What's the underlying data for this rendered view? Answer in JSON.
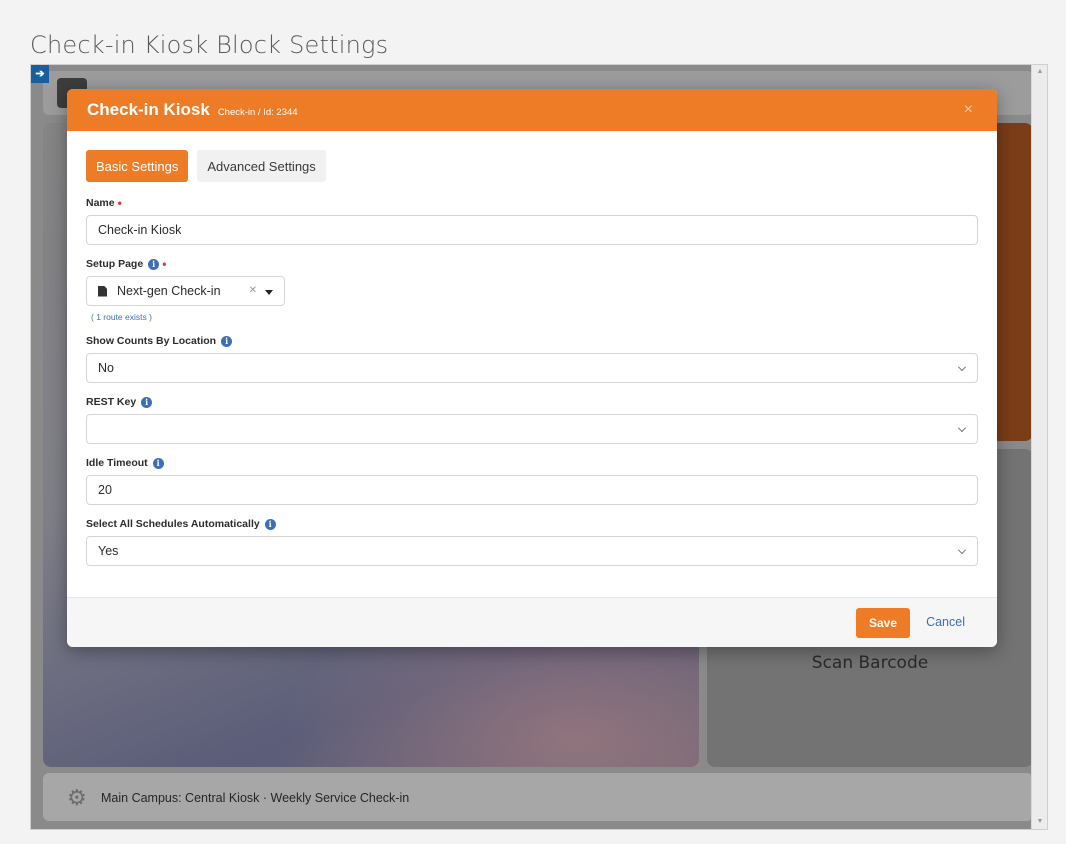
{
  "page": {
    "title": "Check-in Kiosk Block Settings"
  },
  "background": {
    "scan_label": "Scan Barcode",
    "footer_text": "Main Campus: Central Kiosk · Weekly Service Check-in"
  },
  "modal": {
    "title": "Check-in Kiosk",
    "subtitle": "Check-in / Id: 2344",
    "close_glyph": "×",
    "tabs": [
      {
        "label": "Basic Settings",
        "active": true
      },
      {
        "label": "Advanced Settings",
        "active": false
      }
    ],
    "fields": {
      "name": {
        "label": "Name",
        "value": "Check-in Kiosk",
        "required": true
      },
      "setup_page": {
        "label": "Setup Page",
        "value": "Next-gen Check-in",
        "route_note": "( 1 route exists )",
        "required": true
      },
      "show_counts": {
        "label": "Show Counts By Location",
        "value": "No"
      },
      "rest_key": {
        "label": "REST Key",
        "value": ""
      },
      "idle_timeout": {
        "label": "Idle Timeout",
        "value": "20"
      },
      "select_all": {
        "label": "Select All Schedules Automatically",
        "value": "Yes"
      }
    },
    "footer": {
      "save_label": "Save",
      "cancel_label": "Cancel"
    }
  },
  "icons": {
    "info": "info-icon",
    "required": "required-asterisk",
    "close": "close-icon",
    "file": "file-icon",
    "gear": "gear-icon"
  },
  "colors": {
    "accent": "#ee7b25",
    "link": "#3d6fb4",
    "required": "#d93a2f"
  }
}
